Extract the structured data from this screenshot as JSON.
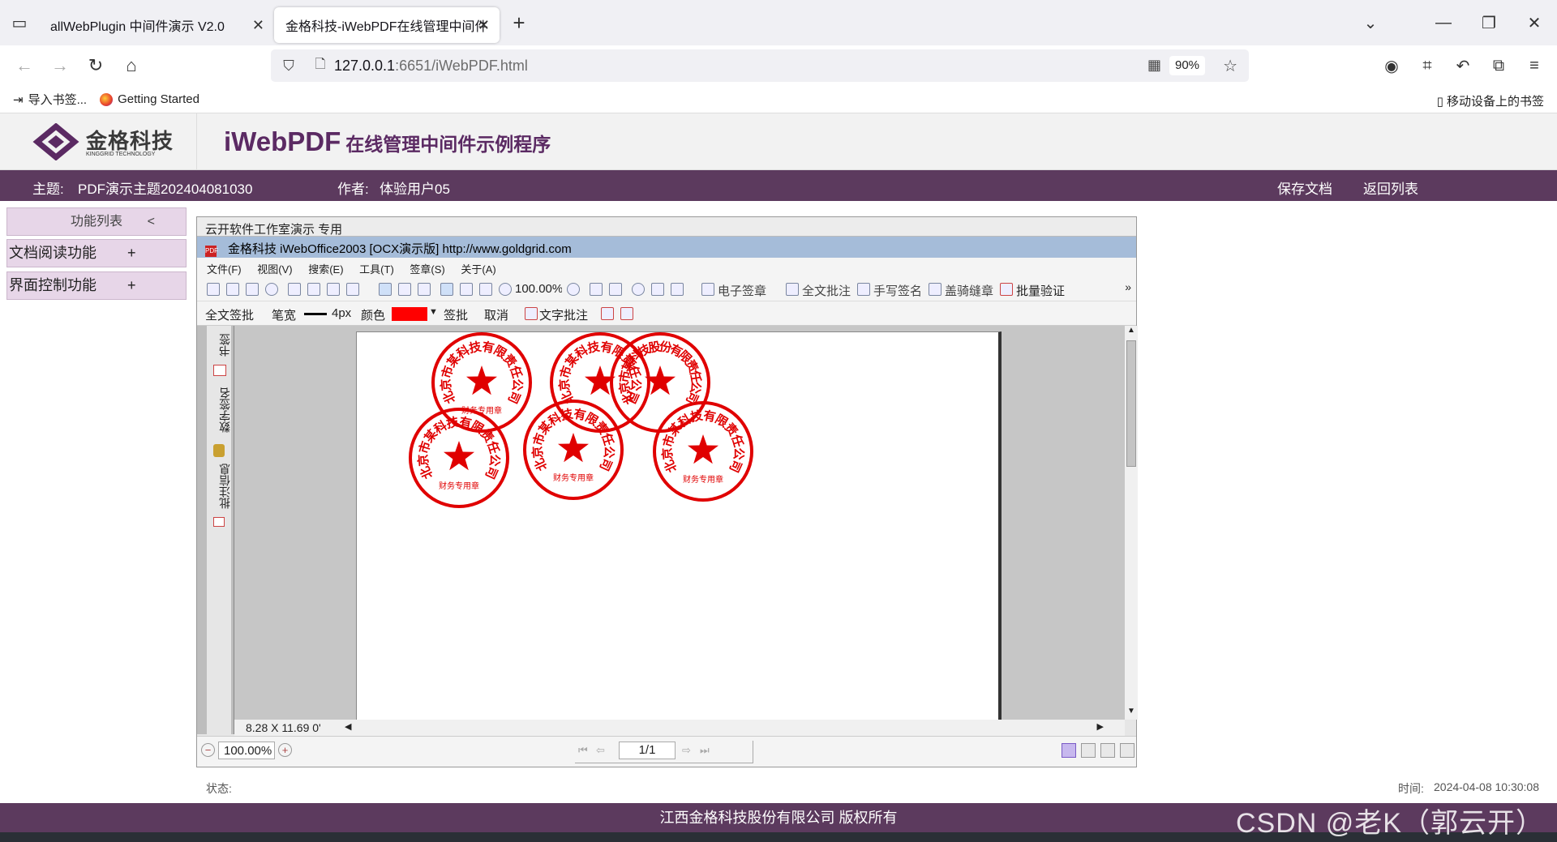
{
  "browser": {
    "tabs": [
      {
        "label": "allWebPlugin 中间件演示 V2.0",
        "active": false
      },
      {
        "label": "金格科技-iWebPDF在线管理中间件",
        "active": true
      }
    ],
    "url_host": "127.0.0.1",
    "url_rest": ":6651/iWebPDF.html",
    "zoom": "90%",
    "bookmarks": [
      "导入书签...",
      "Getting Started"
    ],
    "mobile_bookmarks": "移动设备上的书签"
  },
  "app": {
    "logo_text": "金格科技",
    "logo_sub": "KINGGRID TECHNOLOGY",
    "title_big": "iWebPDF",
    "title_small": "在线管理中间件示例程序",
    "subject_label": "主题:",
    "subject_value": "PDF演示主题202404081030",
    "author_label": "作者:",
    "author_value": "体验用户05",
    "save_doc": "保存文档",
    "back_list": "返回列表",
    "sidebar": {
      "header": "功能列表",
      "collapse": "<",
      "items": [
        {
          "label": "文档阅读功能",
          "expand": "+"
        },
        {
          "label": "界面控制功能",
          "expand": "+"
        }
      ]
    }
  },
  "viewer": {
    "bar1": "云开软件工作室演示  专用",
    "bar2": "金格科技 iWebOffice2003 [OCX演示版]  http://www.goldgrid.com",
    "menu": [
      "文件(F)",
      "视图(V)",
      "搜索(E)",
      "工具(T)",
      "签章(S)",
      "关于(A)"
    ],
    "toolbar_zoom": "100.00%",
    "toolbar_labels": [
      "电子签章",
      "全文批注",
      "手写签名",
      "盖骑缝章",
      "批量验证"
    ],
    "tool2": {
      "full_sign": "全文签批",
      "pen_width": "笔宽",
      "px": "4px",
      "color": "颜色",
      "sign": "签批",
      "cancel": "取消",
      "text_note": "文字批注"
    },
    "side_tabs": [
      "书签",
      "数字签名",
      "批注信息"
    ],
    "page_size": "8.28 X 11.69 0'",
    "status_zoom": "100.00%",
    "page_num": "1/1",
    "stamps": [
      {
        "text": "北京市某科技有限责任公司",
        "footer": "财务专用章"
      },
      {
        "text": "北京市某科技有限责任公司",
        "footer": ""
      },
      {
        "text": "北京市某科技股份有限责任公司",
        "footer": ""
      },
      {
        "text": "北京市某科技有限责任公司",
        "footer": "财务专用章"
      },
      {
        "text": "北京市某科技有限责任公司",
        "footer": "财务专用章"
      },
      {
        "text": "北京市某科技有限责任公司",
        "footer": "财务专用章"
      }
    ],
    "stamp_color": "#e00000"
  },
  "status": {
    "label": "状态:",
    "time_label": "时间:",
    "time_value": "2024-04-08 10:30:08"
  },
  "footer": "江西金格科技股份有限公司 版权所有",
  "watermark": "CSDN @老K（郭云开）",
  "colors": {
    "purple": "#5c3a5e",
    "title": "#5b2a63"
  }
}
